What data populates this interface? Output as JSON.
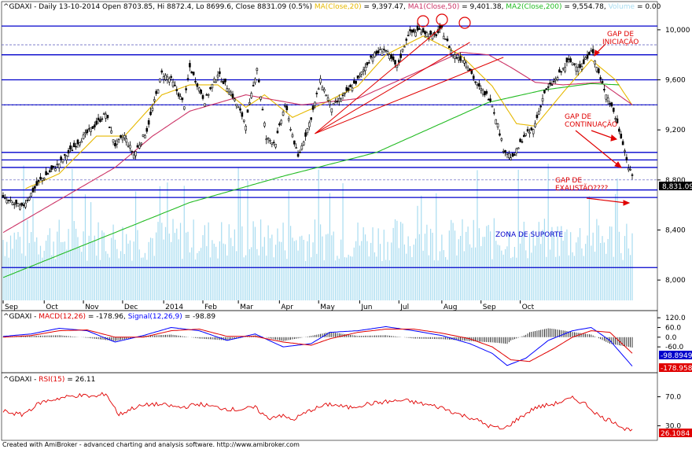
{
  "header": {
    "symbol": "^GDAXI",
    "text": "^GDAXI - Daily 13-10-2014 Open 8703.85, Hi 8872.4, Lo 8699.6, Close 8831.09 (0.5%)",
    "ma": "MA(Close,20)",
    "ma_val": " = 9,397.47, ",
    "ma1": "MA1(Close,50)",
    "ma1_val": " = 9,401.38, ",
    "ma2": "MA2(Close,200)",
    "ma2_val": " = 9,554.78, ",
    "vol": "Volume",
    "vol_val": " = 0.00"
  },
  "macd_header": {
    "prefix": "^GDAXI - ",
    "macd": "MACD(12,26)",
    "macd_val": " = -178.96, ",
    "signal": "Signal(12,26,9)",
    "signal_val": " = -98.89"
  },
  "rsi_header": {
    "prefix": "^GDAXI - ",
    "rsi": "RSI(15)",
    "rsi_val": " = 26.11"
  },
  "annotations": {
    "gap_iniciacao_1": "GAP DE",
    "gap_iniciacao_2": "INICIAÇÃO",
    "gap_continuacao_1": "GAP DE",
    "gap_continuacao_2": "CONTINUAÇÃO",
    "gap_exaustao_1": "GAP DE",
    "gap_exaustao_2": "EXAUSTÃO????",
    "zona": "ZONA DE SUPORTE"
  },
  "footer": "Created with AmiBroker - advanced charting and analysis software. http://www.amibroker.com",
  "colors": {
    "price": "#000000",
    "ma20": "#e6b800",
    "ma50": "#cc3366",
    "ma200": "#22bb22",
    "volume": "#a8dcf0",
    "hline": "#0000cc",
    "trend": "#e00000",
    "macd": "#0000ff",
    "signal": "#e00000",
    "rsi": "#e00000",
    "last_label_bg": "#0000cc"
  },
  "chart_data": [
    {
      "type": "candlestick",
      "title": "^GDAXI - Daily",
      "ylim": [
        7850,
        10150
      ],
      "y_ticks": [
        "10,000",
        "9,600",
        "9,200",
        "8,800",
        "8,400",
        "8,000"
      ],
      "y_tick_values": [
        10000,
        9600,
        9200,
        8800,
        8400,
        8000
      ],
      "x_ticks": [
        "Sep",
        "Oct",
        "Nov",
        "Dec",
        "2014",
        "Feb",
        "Mar",
        "Apr",
        "May",
        "Jun",
        "Jul",
        "Aug",
        "Sep",
        "Oct"
      ],
      "last_label": "8,831.09",
      "series": [
        {
          "name": "^GDAXI",
          "anchors": [
            [
              0,
              8650
            ],
            [
              10,
              8580
            ],
            [
              20,
              8800
            ],
            [
              30,
              8930
            ],
            [
              40,
              9100
            ],
            [
              50,
              9250
            ],
            [
              55,
              9330
            ],
            [
              60,
              9080
            ],
            [
              65,
              9150
            ],
            [
              70,
              9000
            ],
            [
              77,
              9200
            ],
            [
              85,
              9650
            ],
            [
              90,
              9600
            ],
            [
              97,
              9400
            ],
            [
              100,
              9700
            ],
            [
              108,
              9430
            ],
            [
              115,
              9650
            ],
            [
              122,
              9500
            ],
            [
              130,
              9250
            ],
            [
              136,
              9700
            ],
            [
              141,
              9130
            ],
            [
              146,
              9100
            ],
            [
              151,
              9400
            ],
            [
              158,
              8980
            ],
            [
              165,
              9300
            ],
            [
              170,
              9590
            ],
            [
              176,
              9380
            ],
            [
              183,
              9480
            ],
            [
              190,
              9600
            ],
            [
              197,
              9780
            ],
            [
              204,
              9850
            ],
            [
              211,
              9700
            ],
            [
              217,
              9970
            ],
            [
              224,
              10000
            ],
            [
              230,
              9940
            ],
            [
              235,
              10000
            ],
            [
              241,
              9800
            ],
            [
              248,
              9750
            ],
            [
              254,
              9550
            ],
            [
              261,
              9450
            ],
            [
              264,
              9300
            ],
            [
              268,
              9050
            ],
            [
              273,
              8970
            ],
            [
              279,
              9150
            ],
            [
              284,
              9200
            ],
            [
              290,
              9500
            ],
            [
              296,
              9600
            ],
            [
              303,
              9750
            ],
            [
              310,
              9700
            ],
            [
              315,
              9850
            ],
            [
              320,
              9600
            ],
            [
              327,
              9350
            ],
            [
              332,
              9100
            ],
            [
              335,
              8900
            ],
            [
              337,
              8831
            ]
          ]
        },
        {
          "name": "MA(Close,20)",
          "anchors": [
            [
              12,
              8730
            ],
            [
              30,
              8850
            ],
            [
              50,
              9150
            ],
            [
              65,
              9150
            ],
            [
              85,
              9480
            ],
            [
              100,
              9560
            ],
            [
              115,
              9560
            ],
            [
              130,
              9380
            ],
            [
              140,
              9480
            ],
            [
              155,
              9300
            ],
            [
              170,
              9400
            ],
            [
              190,
              9550
            ],
            [
              205,
              9800
            ],
            [
              225,
              9950
            ],
            [
              245,
              9800
            ],
            [
              262,
              9550
            ],
            [
              275,
              9250
            ],
            [
              285,
              9230
            ],
            [
              300,
              9500
            ],
            [
              315,
              9760
            ],
            [
              328,
              9600
            ],
            [
              337,
              9397
            ]
          ]
        },
        {
          "name": "MA1(Close,50)",
          "anchors": [
            [
              0,
              8380
            ],
            [
              30,
              8640
            ],
            [
              60,
              8900
            ],
            [
              80,
              9150
            ],
            [
              100,
              9350
            ],
            [
              130,
              9480
            ],
            [
              160,
              9400
            ],
            [
              190,
              9450
            ],
            [
              220,
              9650
            ],
            [
              245,
              9820
            ],
            [
              260,
              9800
            ],
            [
              272,
              9700
            ],
            [
              285,
              9580
            ],
            [
              300,
              9560
            ],
            [
              320,
              9580
            ],
            [
              337,
              9401
            ]
          ]
        },
        {
          "name": "MA2(Close,200)",
          "anchors": [
            [
              0,
              8020
            ],
            [
              50,
              8320
            ],
            [
              100,
              8620
            ],
            [
              150,
              8830
            ],
            [
              200,
              9020
            ],
            [
              230,
              9220
            ],
            [
              260,
              9420
            ],
            [
              290,
              9520
            ],
            [
              315,
              9570
            ],
            [
              330,
              9560
            ]
          ]
        }
      ],
      "horizontal_lines": [
        10030,
        9800,
        9600,
        9400,
        9020,
        8960,
        8900,
        8720,
        8660,
        8100
      ],
      "volume": {
        "name": "Volume",
        "value": 0.0
      }
    },
    {
      "type": "line",
      "title": "MACD(12,26)",
      "ylim": [
        -210,
        140
      ],
      "y_ticks": [
        "120.0",
        "60.0",
        "0.0",
        "-60.0"
      ],
      "y_tick_values": [
        120,
        60,
        0,
        -60
      ],
      "last_labels": [
        "-98.8949",
        "-178.958"
      ],
      "series": [
        {
          "name": "MACD(12,26)",
          "anchors": [
            [
              0,
              5
            ],
            [
              15,
              20
            ],
            [
              30,
              55
            ],
            [
              45,
              40
            ],
            [
              60,
              -30
            ],
            [
              75,
              10
            ],
            [
              90,
              60
            ],
            [
              105,
              40
            ],
            [
              120,
              -20
            ],
            [
              135,
              20
            ],
            [
              150,
              -60
            ],
            [
              165,
              -40
            ],
            [
              175,
              30
            ],
            [
              190,
              40
            ],
            [
              205,
              65
            ],
            [
              220,
              40
            ],
            [
              235,
              10
            ],
            [
              250,
              -40
            ],
            [
              262,
              -100
            ],
            [
              270,
              -175
            ],
            [
              280,
              -130
            ],
            [
              292,
              -20
            ],
            [
              305,
              40
            ],
            [
              315,
              60
            ],
            [
              325,
              -20
            ],
            [
              337,
              -179
            ]
          ]
        },
        {
          "name": "Signal(12,26,9)",
          "anchors": [
            [
              0,
              0
            ],
            [
              15,
              10
            ],
            [
              30,
              40
            ],
            [
              45,
              45
            ],
            [
              60,
              0
            ],
            [
              75,
              0
            ],
            [
              90,
              40
            ],
            [
              105,
              50
            ],
            [
              120,
              5
            ],
            [
              135,
              5
            ],
            [
              150,
              -30
            ],
            [
              165,
              -50
            ],
            [
              175,
              -10
            ],
            [
              190,
              30
            ],
            [
              205,
              50
            ],
            [
              220,
              50
            ],
            [
              235,
              25
            ],
            [
              250,
              -10
            ],
            [
              262,
              -60
            ],
            [
              272,
              -140
            ],
            [
              282,
              -150
            ],
            [
              295,
              -70
            ],
            [
              305,
              0
            ],
            [
              315,
              40
            ],
            [
              325,
              30
            ],
            [
              337,
              -99
            ]
          ]
        }
      ]
    },
    {
      "type": "line",
      "title": "RSI(15)",
      "ylim": [
        12,
        88
      ],
      "y_ticks": [
        "70.0",
        "30.0"
      ],
      "y_tick_values": [
        70,
        30
      ],
      "last_label": "26.1084",
      "series": [
        {
          "name": "RSI(15)",
          "anchors": [
            [
              0,
              50
            ],
            [
              10,
              45
            ],
            [
              20,
              62
            ],
            [
              30,
              68
            ],
            [
              40,
              72
            ],
            [
              50,
              70
            ],
            [
              55,
              75
            ],
            [
              62,
              45
            ],
            [
              70,
              55
            ],
            [
              80,
              60
            ],
            [
              88,
              58
            ],
            [
              95,
              55
            ],
            [
              105,
              60
            ],
            [
              115,
              55
            ],
            [
              125,
              52
            ],
            [
              135,
              55
            ],
            [
              142,
              40
            ],
            [
              148,
              45
            ],
            [
              155,
              38
            ],
            [
              165,
              52
            ],
            [
              175,
              60
            ],
            [
              185,
              55
            ],
            [
              195,
              60
            ],
            [
              205,
              63
            ],
            [
              215,
              65
            ],
            [
              225,
              60
            ],
            [
              235,
              55
            ],
            [
              245,
              45
            ],
            [
              252,
              40
            ],
            [
              260,
              30
            ],
            [
              268,
              25
            ],
            [
              275,
              38
            ],
            [
              285,
              55
            ],
            [
              295,
              60
            ],
            [
              305,
              68
            ],
            [
              312,
              60
            ],
            [
              320,
              42
            ],
            [
              328,
              35
            ],
            [
              333,
              25
            ],
            [
              337,
              26
            ]
          ]
        }
      ]
    }
  ]
}
